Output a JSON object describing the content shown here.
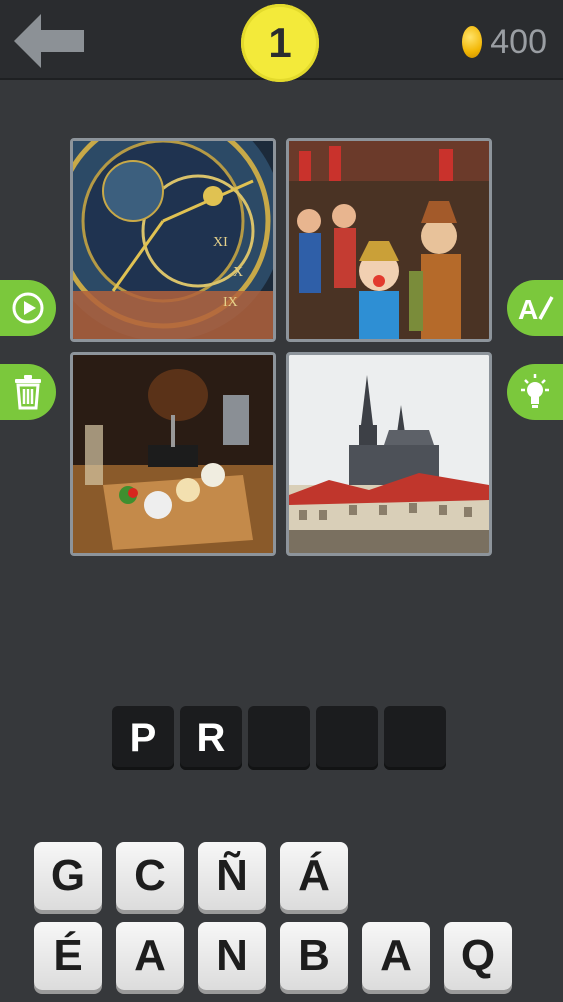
{
  "header": {
    "back_icon": "arrow-left-icon",
    "level_number": "1",
    "coin_icon": "coin-icon",
    "coins": "400"
  },
  "puzzle": {
    "images": [
      {
        "subject": "astronomical-clock"
      },
      {
        "subject": "marionettes"
      },
      {
        "subject": "roast-knuckle-dish"
      },
      {
        "subject": "castle-and-cathedral"
      }
    ]
  },
  "side_buttons": {
    "left": [
      {
        "icon": "play-icon"
      },
      {
        "icon": "trash-icon"
      }
    ],
    "right": [
      {
        "icon": "reveal-letter-icon"
      },
      {
        "icon": "lightbulb-icon"
      }
    ]
  },
  "answer": {
    "slots": [
      "P",
      "R",
      "",
      "",
      ""
    ]
  },
  "letters": {
    "row1": [
      "G",
      "C",
      "Ñ",
      "Á"
    ],
    "row2": [
      "É",
      "A",
      "N",
      "B",
      "A",
      "Q"
    ]
  },
  "colors": {
    "background": "#36383b",
    "topbar": "#2a2c2f",
    "level_badge": "#f3ea3a",
    "action_green": "#7bc83c",
    "slot": "#1b1c1e"
  }
}
